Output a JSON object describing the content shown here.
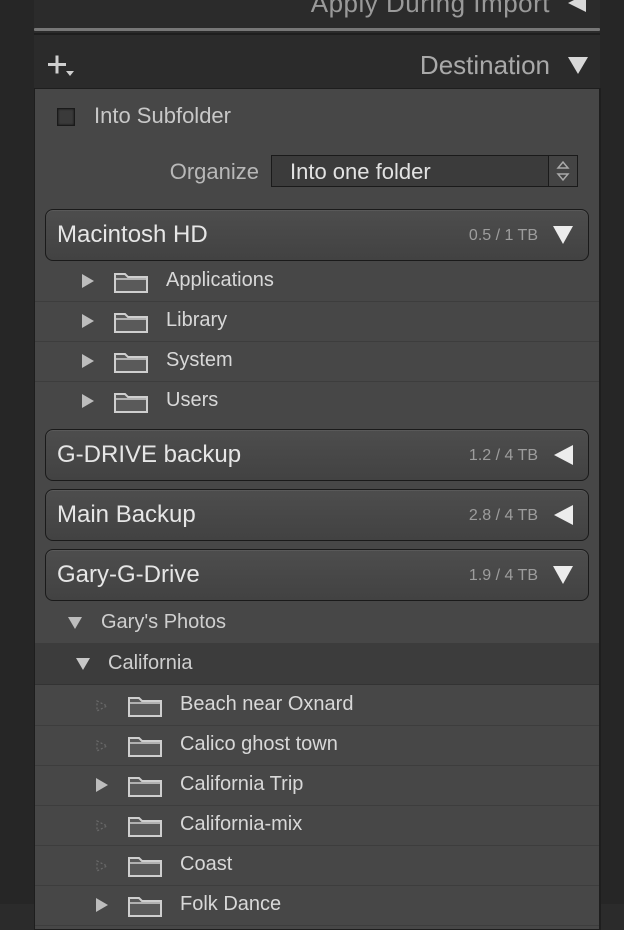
{
  "apply_section": {
    "title": "Apply During Import"
  },
  "destination": {
    "title": "Destination",
    "into_subfolder": {
      "label": "Into Subfolder",
      "checked": false
    },
    "organize": {
      "label": "Organize",
      "value": "Into one folder"
    }
  },
  "volumes": {
    "macintosh_hd": {
      "name": "Macintosh HD",
      "size": "0.5 / 1 TB",
      "expanded": true,
      "folders": [
        "Applications",
        "Library",
        "System",
        "Users"
      ]
    },
    "g_drive_backup": {
      "name": "G-DRIVE backup",
      "size": "1.2 / 4 TB",
      "expanded": false
    },
    "main_backup": {
      "name": "Main Backup",
      "size": "2.8 / 4 TB",
      "expanded": false
    },
    "gary_g_drive": {
      "name": "Gary-G-Drive",
      "size": "1.9 / 4 TB",
      "expanded": true,
      "root_folder": "Gary's Photos",
      "sub_folder": "California",
      "folders": [
        "Beach near Oxnard",
        "Calico ghost town",
        "California Trip",
        "California-mix",
        "Coast",
        "Folk Dance"
      ]
    }
  },
  "colors": {
    "panel_bg": "#474747",
    "header_bg": "#2b2b2b",
    "text": "#d6d6d6"
  }
}
